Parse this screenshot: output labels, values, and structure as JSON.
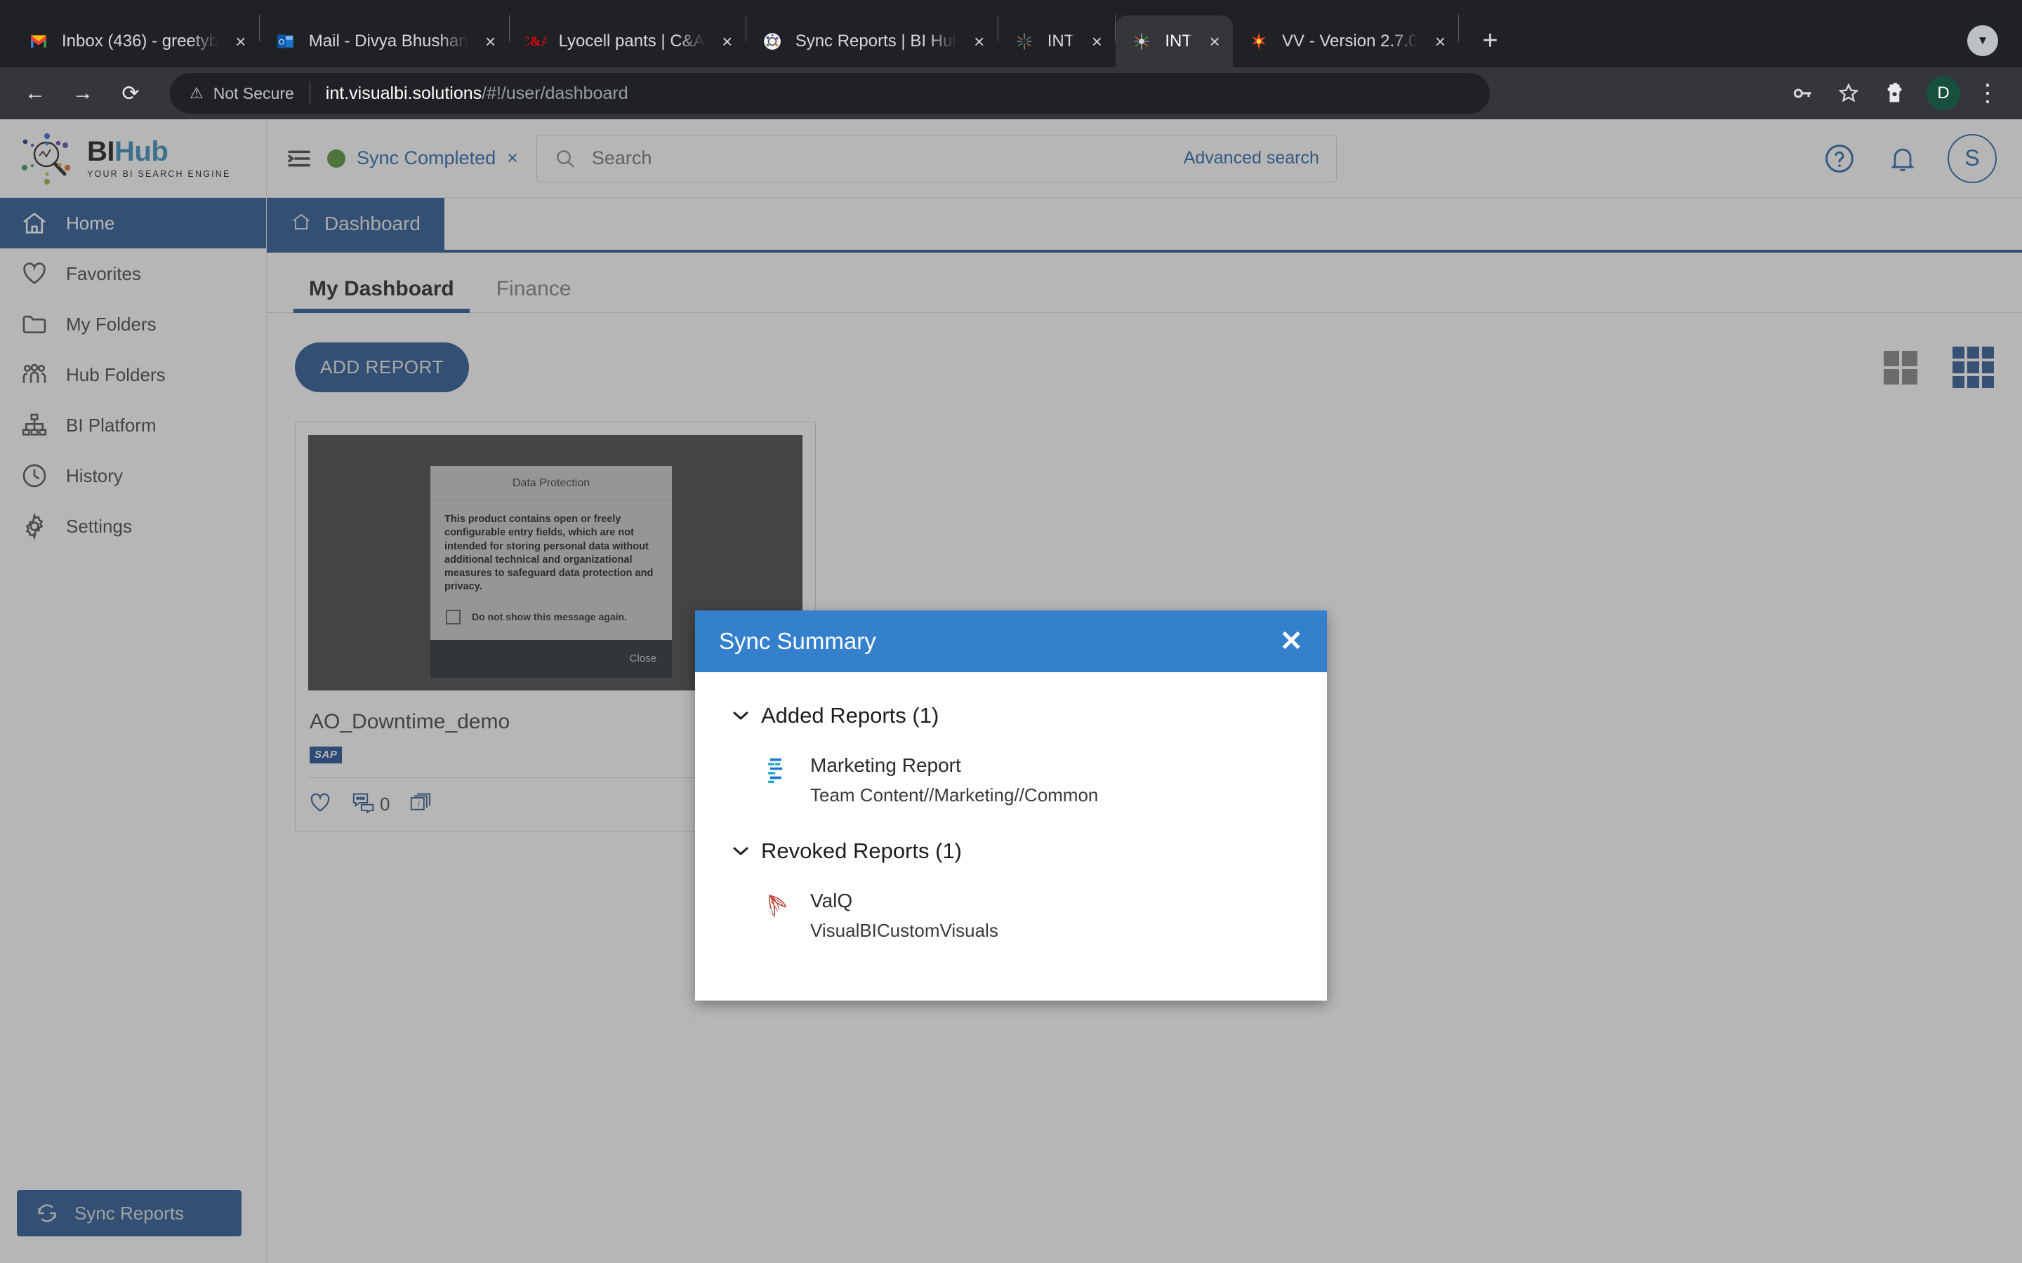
{
  "browser": {
    "tabs": [
      {
        "title": "Inbox (436) - greetyb",
        "favicon": "gmail-icon",
        "active": false
      },
      {
        "title": "Mail - Divya Bhushan",
        "favicon": "outlook-icon",
        "active": false
      },
      {
        "title": "Lyocell pants | C&A",
        "favicon": "ca-icon",
        "active": false
      },
      {
        "title": "Sync Reports | BI Hub",
        "favicon": "bihub-icon",
        "active": false
      },
      {
        "title": "INT",
        "favicon": "int-icon",
        "active": false
      },
      {
        "title": "INT",
        "favicon": "int-icon",
        "active": true
      },
      {
        "title": "VV - Version 2.7.0",
        "favicon": "spark-icon",
        "active": false
      }
    ],
    "new_tab_label": "+",
    "tab_close_label": "×",
    "back_label": "←",
    "forward_label": "→",
    "reload_label": "⟳",
    "security_label": "Not Secure",
    "url_host": "int.visualbi.solutions",
    "url_path": "/#!/user/dashboard",
    "profile_initial": "D",
    "menu_label": "⋮"
  },
  "sidebar": {
    "logo_bi": "BI",
    "logo_hub": "Hub",
    "logo_tagline": "YOUR BI SEARCH ENGINE",
    "items": [
      {
        "label": "Home",
        "icon": "home-icon",
        "active": true
      },
      {
        "label": "Favorites",
        "icon": "heart-icon",
        "active": false
      },
      {
        "label": "My Folders",
        "icon": "folder-icon",
        "active": false
      },
      {
        "label": "Hub Folders",
        "icon": "people-icon",
        "active": false
      },
      {
        "label": "BI Platform",
        "icon": "sitemap-icon",
        "active": false
      },
      {
        "label": "History",
        "icon": "clock-icon",
        "active": false
      },
      {
        "label": "Settings",
        "icon": "gear-icon",
        "active": false
      }
    ],
    "sync_reports_label": "Sync Reports"
  },
  "topbar": {
    "sync_status": "Sync Completed",
    "sync_status_dismiss": "×",
    "status_dot_color": "#4c8c2b",
    "search_placeholder": "Search",
    "advanced_search": "Advanced search",
    "help_label": "?",
    "user_initial": "S"
  },
  "page": {
    "breadcrumb_tab": "Dashboard",
    "subtabs": [
      {
        "label": "My Dashboard",
        "active": true
      },
      {
        "label": "Finance",
        "active": false
      }
    ],
    "add_report_label": "ADD REPORT",
    "view_mode_large": "grid-2x2-view",
    "view_mode_small": "grid-3x3-view"
  },
  "card": {
    "title": "AO_Downtime_demo",
    "platform_badge": "SAP",
    "comment_count": "0",
    "thumbnail": {
      "dialog_title": "Data Protection",
      "dialog_body": "This product contains open or freely configurable entry fields, which are not intended for storing personal data without additional technical and organizational measures to safeguard data protection and privacy.",
      "checkbox_label": "Do not show this message again.",
      "close_label": "Close"
    }
  },
  "modal": {
    "title": "Sync Summary",
    "close_label": "✕",
    "header_color": "#3580cd",
    "sections": [
      {
        "heading": "Added Reports (1)",
        "caret": "⌄",
        "reports": [
          {
            "name": "Marketing Report",
            "path": "Team Content//Marketing//Common",
            "icon": "cognos-report-icon"
          }
        ]
      },
      {
        "heading": "Revoked Reports (1)",
        "caret": "⌄",
        "reports": [
          {
            "name": "ValQ",
            "path": "VisualBICustomVisuals",
            "icon": "ssrs-report-icon"
          }
        ]
      }
    ]
  }
}
